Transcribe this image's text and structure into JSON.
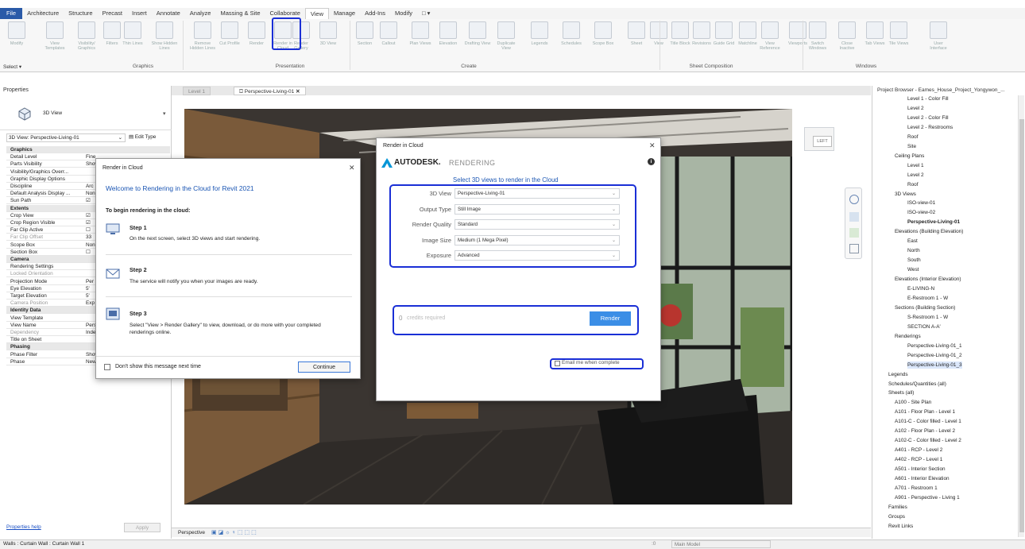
{
  "menu": {
    "items": [
      "File",
      "Architecture",
      "Structure",
      "Precast",
      "Insert",
      "Annotate",
      "Analyze",
      "Massing & Site",
      "Collaborate",
      "View",
      "Manage",
      "Add-Ins",
      "Modify"
    ],
    "active": "View",
    "extra": "□ ▾"
  },
  "ribbon": {
    "panels": [
      "Graphics",
      "Presentation",
      "Create",
      "Sheet Composition",
      "Windows"
    ],
    "select_label": "Select ▾",
    "buttons": [
      "Modify",
      "View Templates",
      "Visibility/ Graphics",
      "Filters",
      "Thin Lines",
      "Show Hidden Lines",
      "Remove Hidden Lines",
      "Cut Profile",
      "Render",
      "Render in Cloud",
      "Render Gallery",
      "3D View",
      "Section",
      "Callout",
      "Plan Views",
      "Elevation",
      "Drafting View",
      "Duplicate View",
      "Legends",
      "Schedules",
      "Scope Box",
      "Sheet",
      "View",
      "Title Block",
      "Revisions",
      "Guide Grid",
      "Matchline",
      "View Reference",
      "Viewports",
      "Switch Windows",
      "Close Inactive",
      "Tab Views",
      "Tile Views",
      "User Interface"
    ]
  },
  "properties": {
    "title": "Properties",
    "type_name": "3D View",
    "selector": "3D View: Perspective-Living-01",
    "edit_type": "Edit Type",
    "rows": [
      {
        "k": "Graphics",
        "v": "",
        "cat": true
      },
      {
        "k": "Detail Level",
        "v": "Fine"
      },
      {
        "k": "Parts Visibility",
        "v": "Show"
      },
      {
        "k": "Visibility/Graphics Overr...",
        "v": ""
      },
      {
        "k": "Graphic Display Options",
        "v": ""
      },
      {
        "k": "Discipline",
        "v": "Arc"
      },
      {
        "k": "Default Analysis Display ...",
        "v": "Non"
      },
      {
        "k": "Sun Path",
        "v": "☑"
      },
      {
        "k": "Extents",
        "v": "",
        "cat": true
      },
      {
        "k": "Crop View",
        "v": "☑"
      },
      {
        "k": "Crop Region Visible",
        "v": "☑"
      },
      {
        "k": "Far Clip Active",
        "v": "☐"
      },
      {
        "k": "Far Clip Offset",
        "v": "33",
        "gray": true
      },
      {
        "k": "Scope Box",
        "v": "Non"
      },
      {
        "k": "Section Box",
        "v": "☐"
      },
      {
        "k": "Camera",
        "v": "",
        "cat": true
      },
      {
        "k": "Rendering Settings",
        "v": ""
      },
      {
        "k": "Locked Orientation",
        "v": "",
        "gray": true
      },
      {
        "k": "Projection Mode",
        "v": "Per"
      },
      {
        "k": "Eye Elevation",
        "v": "5'"
      },
      {
        "k": "Target Elevation",
        "v": "5'"
      },
      {
        "k": "Camera Position",
        "v": "Exp",
        "gray": true
      },
      {
        "k": "Identity Data",
        "v": "",
        "cat": true
      },
      {
        "k": "View Template",
        "v": ""
      },
      {
        "k": "View Name",
        "v": "Perspective-Living-01"
      },
      {
        "k": "Dependency",
        "v": "Independent",
        "gray": true
      },
      {
        "k": "Title on Sheet",
        "v": ""
      },
      {
        "k": "Phasing",
        "v": "",
        "cat": true
      },
      {
        "k": "Phase Filter",
        "v": "Show All"
      },
      {
        "k": "Phase",
        "v": "New Construction"
      }
    ],
    "help": "Properties help",
    "apply": "Apply"
  },
  "tabs": [
    {
      "label": "Level 1",
      "active": false
    },
    {
      "label": "Perspective-Living-01",
      "active": true
    }
  ],
  "status": {
    "left": "Walls : Curtain Wall : Curtain Wall 1",
    "model": "Main Model",
    "zero": ":0"
  },
  "viewbar": {
    "label": "Perspective"
  },
  "browser": {
    "title": "Project Browser - Eames_House_Project_Yongywon_...",
    "items": [
      {
        "t": "Level 1 - Color Fill",
        "i": 4
      },
      {
        "t": "Level 2",
        "i": 4
      },
      {
        "t": "Level 2 - Color Fill",
        "i": 4
      },
      {
        "t": "Level 2 - Restrooms",
        "i": 4
      },
      {
        "t": "Roof",
        "i": 4
      },
      {
        "t": "Site",
        "i": 4
      },
      {
        "t": "Ceiling Plans",
        "i": 2
      },
      {
        "t": "Level 1",
        "i": 4
      },
      {
        "t": "Level 2",
        "i": 4
      },
      {
        "t": "Roof",
        "i": 4
      },
      {
        "t": "3D Views",
        "i": 2
      },
      {
        "t": "ISO-view-01",
        "i": 4
      },
      {
        "t": "ISO-view-02",
        "i": 4
      },
      {
        "t": "Perspective-Living-01",
        "i": 4,
        "bold": true
      },
      {
        "t": "Elevations (Building Elevation)",
        "i": 2
      },
      {
        "t": "East",
        "i": 4
      },
      {
        "t": "North",
        "i": 4
      },
      {
        "t": "South",
        "i": 4
      },
      {
        "t": "West",
        "i": 4
      },
      {
        "t": "Elevations (Interior Elevation)",
        "i": 2
      },
      {
        "t": "E-LIVING-N",
        "i": 4
      },
      {
        "t": "E-Restroom 1 - W",
        "i": 4
      },
      {
        "t": "Sections (Building Section)",
        "i": 2
      },
      {
        "t": "S-Restroom 1 - W",
        "i": 4
      },
      {
        "t": "SECTION A-A'",
        "i": 4
      },
      {
        "t": "Renderings",
        "i": 2
      },
      {
        "t": "Perspective-Living-01_1",
        "i": 4
      },
      {
        "t": "Perspective-Living-01_2",
        "i": 4
      },
      {
        "t": "Perspective-Living-01_3",
        "i": 4,
        "sel": true
      },
      {
        "t": "Legends",
        "i": 1
      },
      {
        "t": "Schedules/Quantities (all)",
        "i": 1
      },
      {
        "t": "Sheets (all)",
        "i": 1
      },
      {
        "t": "A100 - Site Plan",
        "i": 2
      },
      {
        "t": "A101 - Floor Plan - Level 1",
        "i": 2
      },
      {
        "t": "A101-C - Color filled - Level 1",
        "i": 2
      },
      {
        "t": "A102 - Floor Plan - Level 2",
        "i": 2
      },
      {
        "t": "A102-C - Color filled - Level 2",
        "i": 2
      },
      {
        "t": "A401 - RCP - Level 2",
        "i": 2
      },
      {
        "t": "A402 - RCP - Level 1",
        "i": 2
      },
      {
        "t": "A501 - Interior Section",
        "i": 2
      },
      {
        "t": "A601 - Interior Elevation",
        "i": 2
      },
      {
        "t": "A701 - Restroom 1",
        "i": 2
      },
      {
        "t": "A901 - Perspective - Living 1",
        "i": 2
      },
      {
        "t": "Families",
        "i": 1
      },
      {
        "t": "Groups",
        "i": 1
      },
      {
        "t": "Revit Links",
        "i": 1
      }
    ]
  },
  "viewcube": {
    "label": "LEFT"
  },
  "dialog1": {
    "title": "Render in Cloud",
    "close": "✕",
    "welcome": "Welcome to Rendering in the Cloud for Revit 2021",
    "intro": "To begin rendering in the cloud:",
    "steps": [
      {
        "title": "Step 1",
        "text": "On the next screen, select 3D views and start rendering."
      },
      {
        "title": "Step 2",
        "text": "The service will notify you when your images are ready."
      },
      {
        "title": "Step 3",
        "text": "Select \"View > Render Gallery\" to view, download, or do more with your completed renderings online."
      }
    ],
    "dont_show": "Don't show this message next time",
    "continue": "Continue"
  },
  "dialog2": {
    "title": "Render in Cloud",
    "close": "✕",
    "brand": "AUTODESK.",
    "brand_sub": "RENDERING",
    "info": "i",
    "subtitle": "Select 3D views to render in the Cloud",
    "fields": [
      {
        "label": "3D View",
        "value": "Perspective-Living-01"
      },
      {
        "label": "Output Type",
        "value": "Still Image"
      },
      {
        "label": "Render Quality",
        "value": "Standard"
      },
      {
        "label": "Image Size",
        "value": "Medium (1 Mega Pixel)"
      },
      {
        "label": "Exposure",
        "value": "Advanced"
      }
    ],
    "credits_count": "0",
    "credits_label": "credits required",
    "render": "Render",
    "email": "Email me when complete",
    "accent": "#1a2fd6",
    "render_color": "#3b8ee6"
  }
}
